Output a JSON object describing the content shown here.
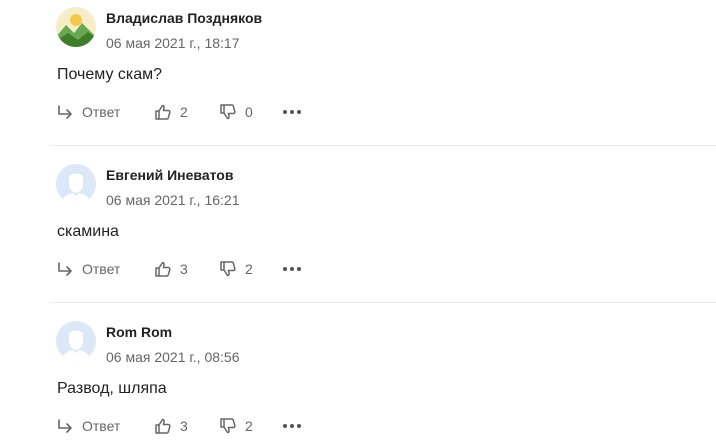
{
  "comments": [
    {
      "author": "Владислав Поздняков",
      "date": "06 мая 2021 г., 18:17",
      "text": "Почему скам?",
      "reply_label": "Ответ",
      "likes": "2",
      "dislikes": "0",
      "avatar": "landscape-photo"
    },
    {
      "author": "Евгений Иневатов",
      "date": "06 мая 2021 г., 16:21",
      "text": "скамина",
      "reply_label": "Ответ",
      "likes": "3",
      "dislikes": "2",
      "avatar": "default-user"
    },
    {
      "author": "Rom Rom",
      "date": "06 мая 2021 г., 08:56",
      "text": "Развод, шляпа",
      "reply_label": "Ответ",
      "likes": "3",
      "dislikes": "2",
      "avatar": "default-user"
    }
  ],
  "colors": {
    "text": "#222222",
    "muted": "#666666",
    "divider": "#e8e8e8",
    "default_avatar_bg": "#dce8f7",
    "default_avatar_fg": "#ffffff"
  }
}
